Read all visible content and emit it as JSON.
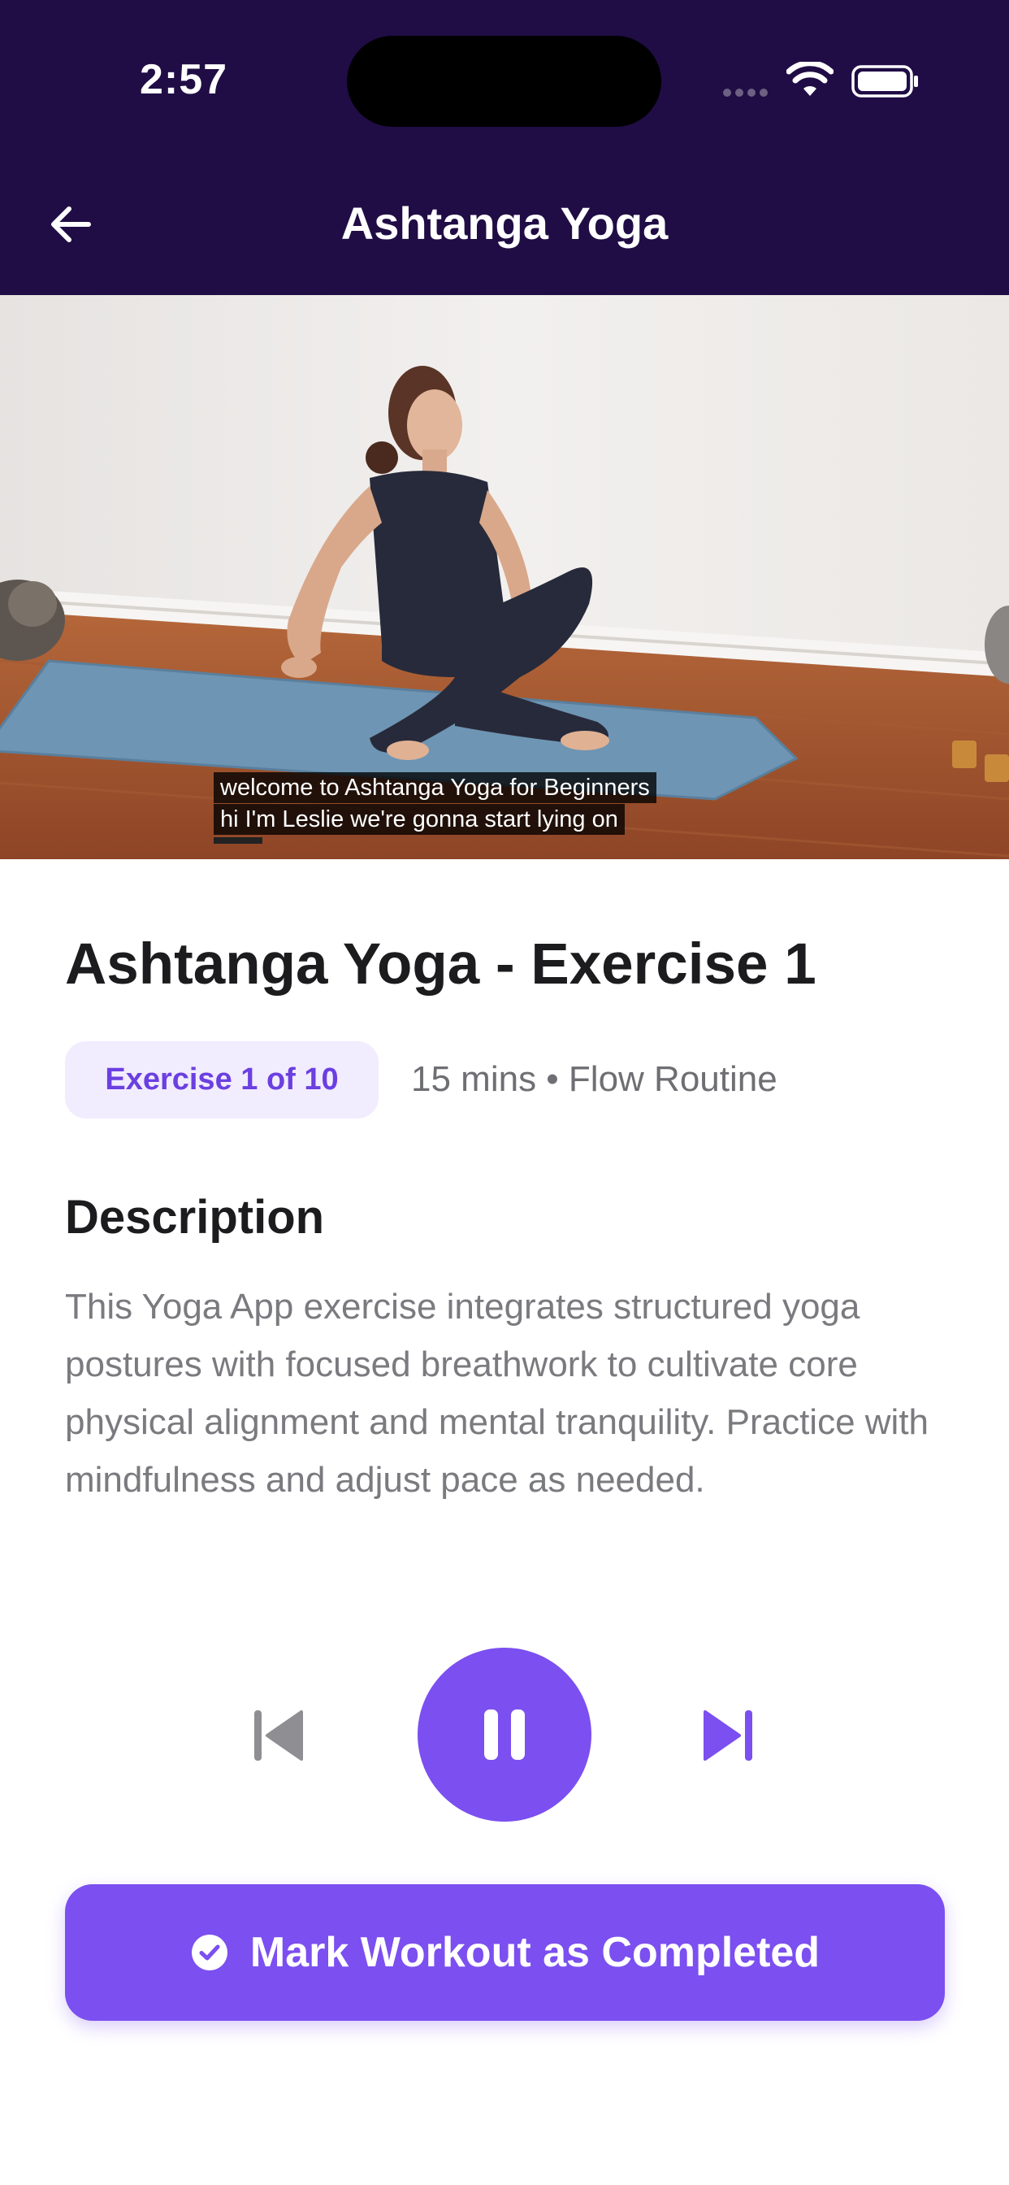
{
  "status_bar": {
    "time": "2:57"
  },
  "header": {
    "title": "Ashtanga Yoga"
  },
  "video": {
    "captions": [
      "welcome to Ashtanga Yoga for Beginners",
      "hi I'm Leslie we're gonna start lying on"
    ]
  },
  "exercise": {
    "title": "Ashtanga Yoga - Exercise 1",
    "badge": "Exercise 1 of 10",
    "meta": "15 mins • Flow Routine"
  },
  "description": {
    "heading": "Description",
    "body": "This Yoga App exercise integrates structured yoga postures with focused breathwork to cultivate core physical alignment and mental tranquility. Practice with mindfulness and adjust pace as needed."
  },
  "controls": {
    "state": "playing"
  },
  "complete_button": {
    "label": "Mark Workout as Completed"
  },
  "colors": {
    "header_bg": "#200d45",
    "accent": "#7b4ff0",
    "badge_bg": "#f1ecfe",
    "badge_text": "#6b3fe0",
    "text_primary": "#1c1c1e",
    "text_secondary": "#7a7a7f"
  },
  "icons": {
    "back": "arrow-left-icon",
    "previous": "skip-previous-icon",
    "pause": "pause-icon",
    "next": "skip-next-icon",
    "check": "check-circle-icon"
  }
}
